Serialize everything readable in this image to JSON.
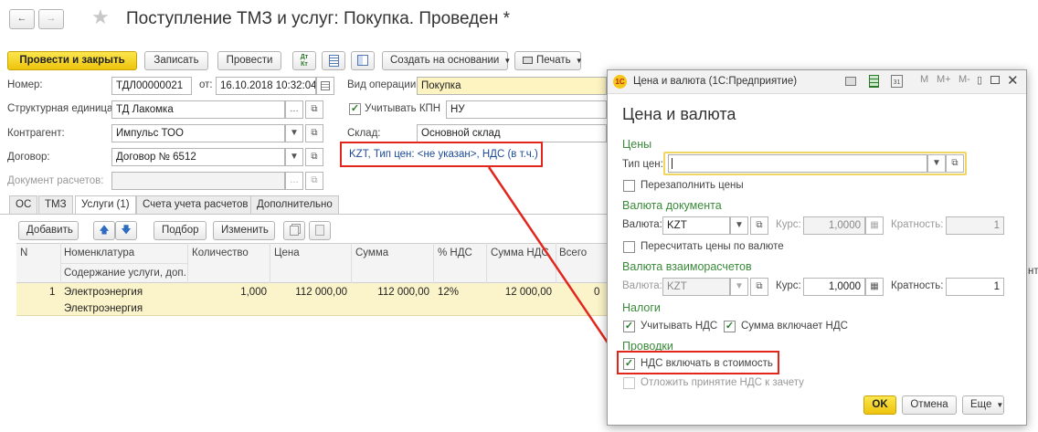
{
  "header": {
    "title": "Поступление ТМЗ и услуг: Покупка. Проведен *",
    "back_glyph": "←",
    "forward_glyph": "→",
    "star_glyph": "★"
  },
  "toolbar": {
    "post_close": "Провести и закрыть",
    "save": "Записать",
    "post": "Провести",
    "dtkt_icon": "Дт Кт",
    "create_based": "Создать на основании",
    "print": "Печать"
  },
  "form": {
    "number_label": "Номер:",
    "number_value": "ТДЛ00000021",
    "date_label": "от:",
    "date_value": "16.10.2018 10:32:04",
    "operation_label": "Вид операции:",
    "operation_value": "Покупка",
    "unit_label": "Структурная единица:",
    "unit_value": "ТД Лакомка",
    "kpn_label": "Учитывать КПН",
    "kpn_value": "НУ",
    "contractor_label": "Контрагент:",
    "contractor_value": "Импульс ТОО",
    "warehouse_label": "Склад:",
    "warehouse_value": "Основной склад",
    "contract_label": "Договор:",
    "contract_value": "Договор № 6512",
    "price_link": "KZT, Тип цен: <не указан>, НДС (в т.ч.)",
    "settlement_doc_label": "Документ расчетов:"
  },
  "tabs": [
    "ОС",
    "ТМЗ",
    "Услуги (1)",
    "Счета учета расчетов",
    "Дополнительно"
  ],
  "table_toolbar": {
    "add": "Добавить",
    "up_glyph": "🡅",
    "down_glyph": "🡇",
    "pick": "Подбор",
    "edit": "Изменить"
  },
  "table": {
    "headers": {
      "n": "N",
      "item": "Номенклатура",
      "item_sub": "Содержание услуги, доп.",
      "qty": "Количество",
      "price": "Цена",
      "sum": "Сумма",
      "vat_pct": "% НДС",
      "vat_sum": "Сумма НДС",
      "total": "Всего",
      "cut": "нт"
    },
    "rows": [
      {
        "n": "1",
        "item": "Электроэнергия",
        "item_sub": "Электроэнергия",
        "qty": "1,000",
        "price": "112 000,00",
        "sum": "112 000,00",
        "vat_pct": "12%",
        "vat_sum": "12 000,00",
        "total_cut": "0"
      }
    ]
  },
  "dialog": {
    "window_title": "Цена и валюта  (1С:Предприятие)",
    "heading": "Цена и валюта",
    "section_prices": "Цены",
    "price_type_label": "Тип цен:",
    "price_type_value": "",
    "refill_prices": "Перезаполнить цены",
    "section_doc_currency": "Валюта документа",
    "currency_label": "Валюта:",
    "currency_value": "KZT",
    "rate_label": "Курс:",
    "rate_value": "1,0000",
    "multiplicity_label": "Кратность:",
    "multiplicity_value": "1",
    "recalc_prices": "Пересчитать цены по валюте",
    "section_settle_currency": "Валюта взаиморасчетов",
    "settle_currency_value": "KZT",
    "settle_rate_label": "Курс:",
    "settle_rate_value": "1,0000",
    "settle_multiplicity_label": "Кратность:",
    "settle_multiplicity_value": "1",
    "section_taxes": "Налоги",
    "consider_vat": "Учитывать НДС",
    "sum_includes_vat": "Сумма включает НДС",
    "section_postings": "Проводки",
    "vat_in_cost": "НДС включать в стоимость",
    "defer_vat": "Отложить принятие НДС к зачету",
    "ok": "OK",
    "cancel": "Отмена",
    "more": "Еще",
    "tb_m": "M",
    "tb_mplus": "M+",
    "tb_mminus": "M-",
    "tb_calendar_num": "31"
  },
  "colors": {
    "primary_button": "#f5d327",
    "section_green": "#3a8a3a",
    "highlight_red": "#e3261c",
    "row_highlight": "#fbf3c9",
    "link_blue": "#1d4a97"
  }
}
